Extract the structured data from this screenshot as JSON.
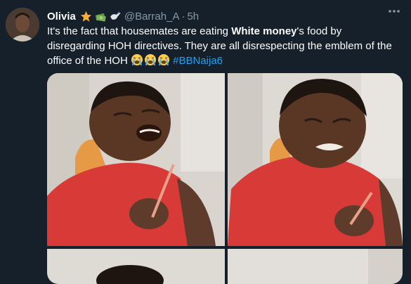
{
  "tweet": {
    "author_name": "Olivia",
    "author_badges": [
      "star-emoji",
      "money-emoji",
      "dove-emoji"
    ],
    "handle": "@Barrah_A",
    "separator": "·",
    "time": "5h",
    "more_label": "•••",
    "text": {
      "part1": "It's the fact that housemates are eating ",
      "bold": "White money",
      "part2": "'s food by disregarding HOH directives. They are all disrespecting the emblem of the office of the HOH ",
      "emoji": "crying-emoji",
      "hashtag": "#BBNaija6"
    }
  },
  "media": {
    "panels": [
      "laughing-boy-photo",
      "crying-boy-photo",
      "photo-bottom-left",
      "photo-bottom-right"
    ]
  },
  "colors": {
    "background": "#15202b",
    "text": "#ffffff",
    "muted": "#8899a6",
    "link": "#1da1f2",
    "shirt": "#d83a37"
  }
}
